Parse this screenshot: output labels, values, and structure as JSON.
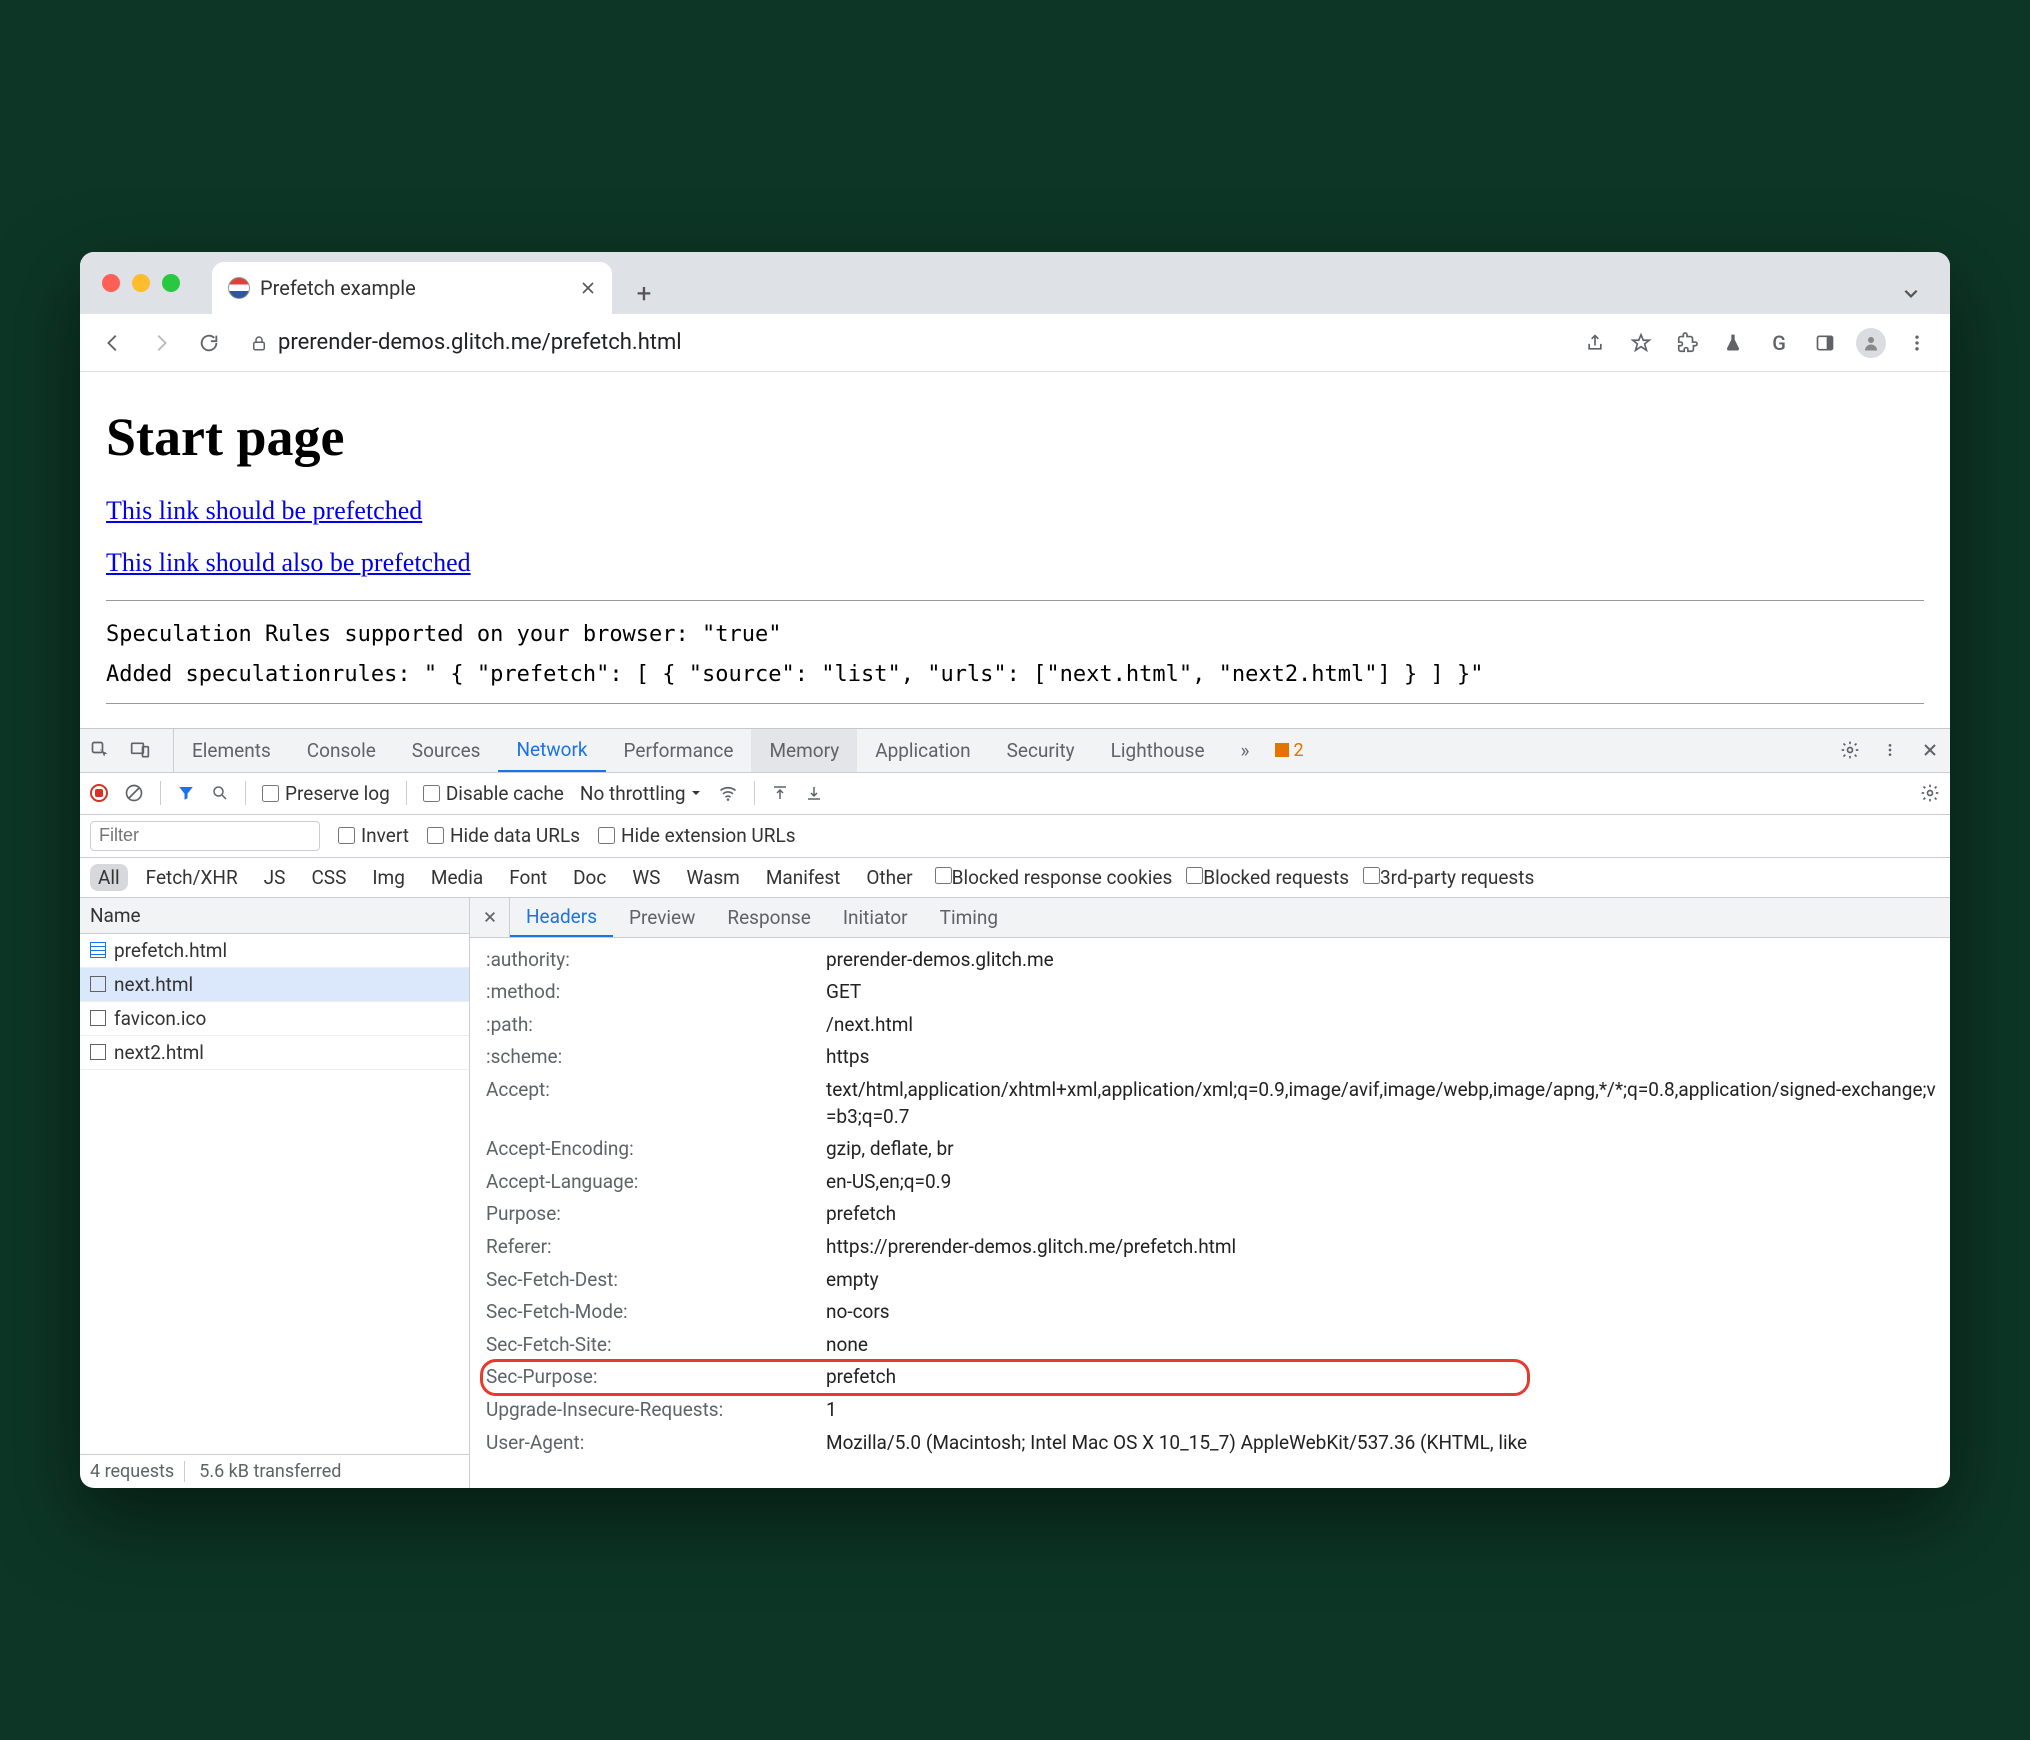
{
  "browser": {
    "tab_title": "Prefetch example",
    "url": "prerender-demos.glitch.me/prefetch.html",
    "toolbar_icons": [
      "share-icon",
      "star-icon",
      "puzzle-icon",
      "flask-icon",
      "g-icon",
      "panel-icon",
      "profile-icon",
      "kebab-icon"
    ]
  },
  "page": {
    "heading": "Start page",
    "link1": "This link should be prefetched",
    "link2": "This link should also be prefetched",
    "mono1": "Speculation Rules supported on your browser: \"true\"",
    "mono2": "Added speculationrules: \" { \"prefetch\": [ { \"source\": \"list\", \"urls\": [\"next.html\", \"next2.html\"] } ] }\""
  },
  "devtools": {
    "panels": [
      "Elements",
      "Console",
      "Sources",
      "Network",
      "Performance",
      "Memory",
      "Application",
      "Security",
      "Lighthouse"
    ],
    "active_panel": "Network",
    "highlight_panel": "Memory",
    "more_label": "»",
    "warn_count": "2",
    "bar": {
      "preserve_log": "Preserve log",
      "disable_cache": "Disable cache",
      "throttling": "No throttling"
    },
    "filter": {
      "placeholder": "Filter",
      "invert": "Invert",
      "hide_data": "Hide data URLs",
      "hide_ext": "Hide extension URLs"
    },
    "types": [
      "All",
      "Fetch/XHR",
      "JS",
      "CSS",
      "Img",
      "Media",
      "Font",
      "Doc",
      "WS",
      "Wasm",
      "Manifest",
      "Other"
    ],
    "type_checks": {
      "blocked_cookies": "Blocked response cookies",
      "blocked_req": "Blocked requests",
      "third_party": "3rd-party requests"
    },
    "name_header": "Name",
    "requests": [
      {
        "name": "prefetch.html",
        "icon": "doc"
      },
      {
        "name": "next.html",
        "icon": "file",
        "selected": true
      },
      {
        "name": "favicon.ico",
        "icon": "file"
      },
      {
        "name": "next2.html",
        "icon": "file"
      }
    ],
    "status": {
      "count": "4 requests",
      "transferred": "5.6 kB transferred"
    },
    "subtabs": [
      "Headers",
      "Preview",
      "Response",
      "Initiator",
      "Timing"
    ],
    "active_subtab": "Headers",
    "headers": [
      {
        "k": ":authority:",
        "v": "prerender-demos.glitch.me"
      },
      {
        "k": ":method:",
        "v": "GET"
      },
      {
        "k": ":path:",
        "v": "/next.html"
      },
      {
        "k": ":scheme:",
        "v": "https"
      },
      {
        "k": "Accept:",
        "v": "text/html,application/xhtml+xml,application/xml;q=0.9,image/avif,image/webp,image/apng,*/*;q=0.8,application/signed-exchange;v=b3;q=0.7"
      },
      {
        "k": "Accept-Encoding:",
        "v": "gzip, deflate, br"
      },
      {
        "k": "Accept-Language:",
        "v": "en-US,en;q=0.9"
      },
      {
        "k": "Purpose:",
        "v": "prefetch"
      },
      {
        "k": "Referer:",
        "v": "https://prerender-demos.glitch.me/prefetch.html"
      },
      {
        "k": "Sec-Fetch-Dest:",
        "v": "empty"
      },
      {
        "k": "Sec-Fetch-Mode:",
        "v": "no-cors"
      },
      {
        "k": "Sec-Fetch-Site:",
        "v": "none"
      },
      {
        "k": "Sec-Purpose:",
        "v": "prefetch",
        "marked": true
      },
      {
        "k": "Upgrade-Insecure-Requests:",
        "v": "1"
      },
      {
        "k": "User-Agent:",
        "v": "Mozilla/5.0 (Macintosh; Intel Mac OS X 10_15_7) AppleWebKit/537.36 (KHTML, like"
      }
    ]
  }
}
